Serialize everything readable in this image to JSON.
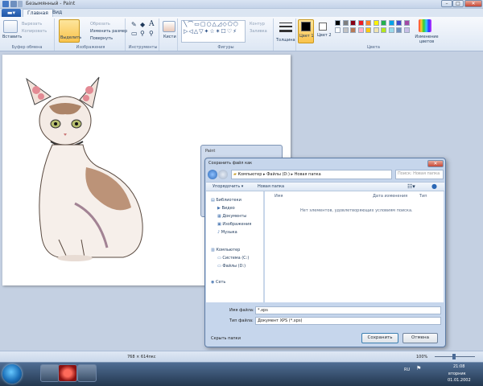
{
  "window": {
    "title": "Безымянный - Paint",
    "minimize": "–",
    "maximize": "□",
    "close": "✕"
  },
  "tabs": {
    "file": "▬▾",
    "home": "Главная",
    "view": "Вид"
  },
  "ribbon": {
    "clipboard": {
      "paste": "Вставить",
      "cut": "Вырезать",
      "copy": "Копировать",
      "label": "Буфер обмена"
    },
    "image": {
      "select": "Выделить",
      "crop": "Обрезать",
      "resize": "Изменить размер",
      "rotate": "Повернуть",
      "label": "Изображения"
    },
    "tools": {
      "label": "Инструменты",
      "text": "A"
    },
    "brushes": {
      "label": "Кисти"
    },
    "shapes": {
      "outline": "Контур",
      "fill": "Заливка",
      "label": "Фигуры"
    },
    "size": {
      "label": "Толщина"
    },
    "color1": {
      "label": "Цвет 1"
    },
    "color2": {
      "label": "Цвет 2"
    },
    "colors": {
      "label": "Цвета",
      "edit": "Изменение цветов"
    },
    "palette": [
      "#000000",
      "#7f7f7f",
      "#880015",
      "#ed1c24",
      "#ff7f27",
      "#fff200",
      "#22b14c",
      "#00a2e8",
      "#3f48cc",
      "#a349a4",
      "#ffffff",
      "#c3c3c3",
      "#b97a57",
      "#ffaec9",
      "#ffc90e",
      "#efe4b0",
      "#b5e61d",
      "#99d9ea",
      "#7092be",
      "#c8bfe7"
    ]
  },
  "paint_small_dialog": {
    "title": "Paint"
  },
  "dialog": {
    "title": "Сохранить файл как",
    "breadcrumb": [
      "Компьютер",
      "Файлы (D:)",
      "Новая папка"
    ],
    "search_placeholder": "Поиск: Новая папка",
    "toolbar": {
      "organize": "Упорядочить ▾",
      "new_folder": "Новая папка"
    },
    "nav": [
      {
        "label": "Библиотеки",
        "level": 0
      },
      {
        "label": "Видео",
        "level": 1
      },
      {
        "label": "Документы",
        "level": 1
      },
      {
        "label": "Изображения",
        "level": 1
      },
      {
        "label": "Музыка",
        "level": 1
      },
      {
        "label": "Компьютер",
        "level": 0
      },
      {
        "label": "Система (C:)",
        "level": 1
      },
      {
        "label": "Файлы (D:)",
        "level": 1
      },
      {
        "label": "Сеть",
        "level": 0
      }
    ],
    "columns": {
      "name": "Имя",
      "date": "Дата изменения",
      "type": "Тип"
    },
    "empty_message": "Нет элементов, удовлетворяющих условиям поиска.",
    "filename_label": "Имя файла:",
    "filename_value": "*.xps",
    "filetype_label": "Тип файла:",
    "filetype_value": "Документ XPS (*.xps)",
    "hide_folders": "Скрыть папки",
    "save": "Сохранить",
    "cancel": "Отмена"
  },
  "status": {
    "dimensions": "768 × 614пкс",
    "zoom": "100%"
  },
  "taskbar": {
    "lang": "RU",
    "time": "21:08",
    "day": "вторник",
    "date": "01.01.2002"
  }
}
